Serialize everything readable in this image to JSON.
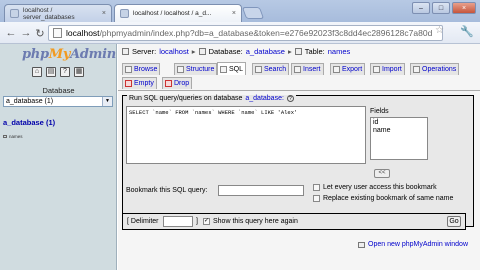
{
  "browser": {
    "tabs": [
      {
        "title": "localhost / server_databases"
      },
      {
        "title": "localhost / localhost / a_d..."
      }
    ],
    "address": {
      "host": "localhost",
      "path": "/phpmyadmin/index.php?db=a_database&token=e276e92023f3c8dd4ec2896128c7a80d"
    }
  },
  "left": {
    "logo_php": "php",
    "logo_my": "My",
    "logo_admin": "Admin",
    "database_label": "Database",
    "database_selected": "a_database (1)",
    "db_name": "a_database (1)",
    "table_name": "names"
  },
  "main": {
    "breadcrumb": {
      "server_label": "Server:",
      "server_value": "localhost",
      "db_label": "Database:",
      "db_value": "a_database",
      "table_label": "Table:",
      "table_value": "names"
    },
    "tabs": [
      "Browse",
      "Structure",
      "SQL",
      "Search",
      "Insert",
      "Export",
      "Import",
      "Operations",
      "Empty",
      "Drop"
    ],
    "query_legend": "Run SQL query/queries on database",
    "query_db": "a_database:",
    "query_text": "SELECT `name` FROM `names` WHERE `name` LIKE 'Alex'",
    "fields_label": "Fields",
    "fields": [
      "id",
      "name"
    ],
    "insert_btn": "<<",
    "bookmark_label": "Bookmark this SQL query:",
    "bookmark_opt1": "Let every user access this bookmark",
    "bookmark_opt2": "Replace existing bookmark of same name",
    "delimiter_label": "[ Delimiter",
    "delimiter_end": "]",
    "show_query_label": "Show this query here again",
    "go_label": "Go",
    "new_window_label": "Open new phpMyAdmin window"
  }
}
